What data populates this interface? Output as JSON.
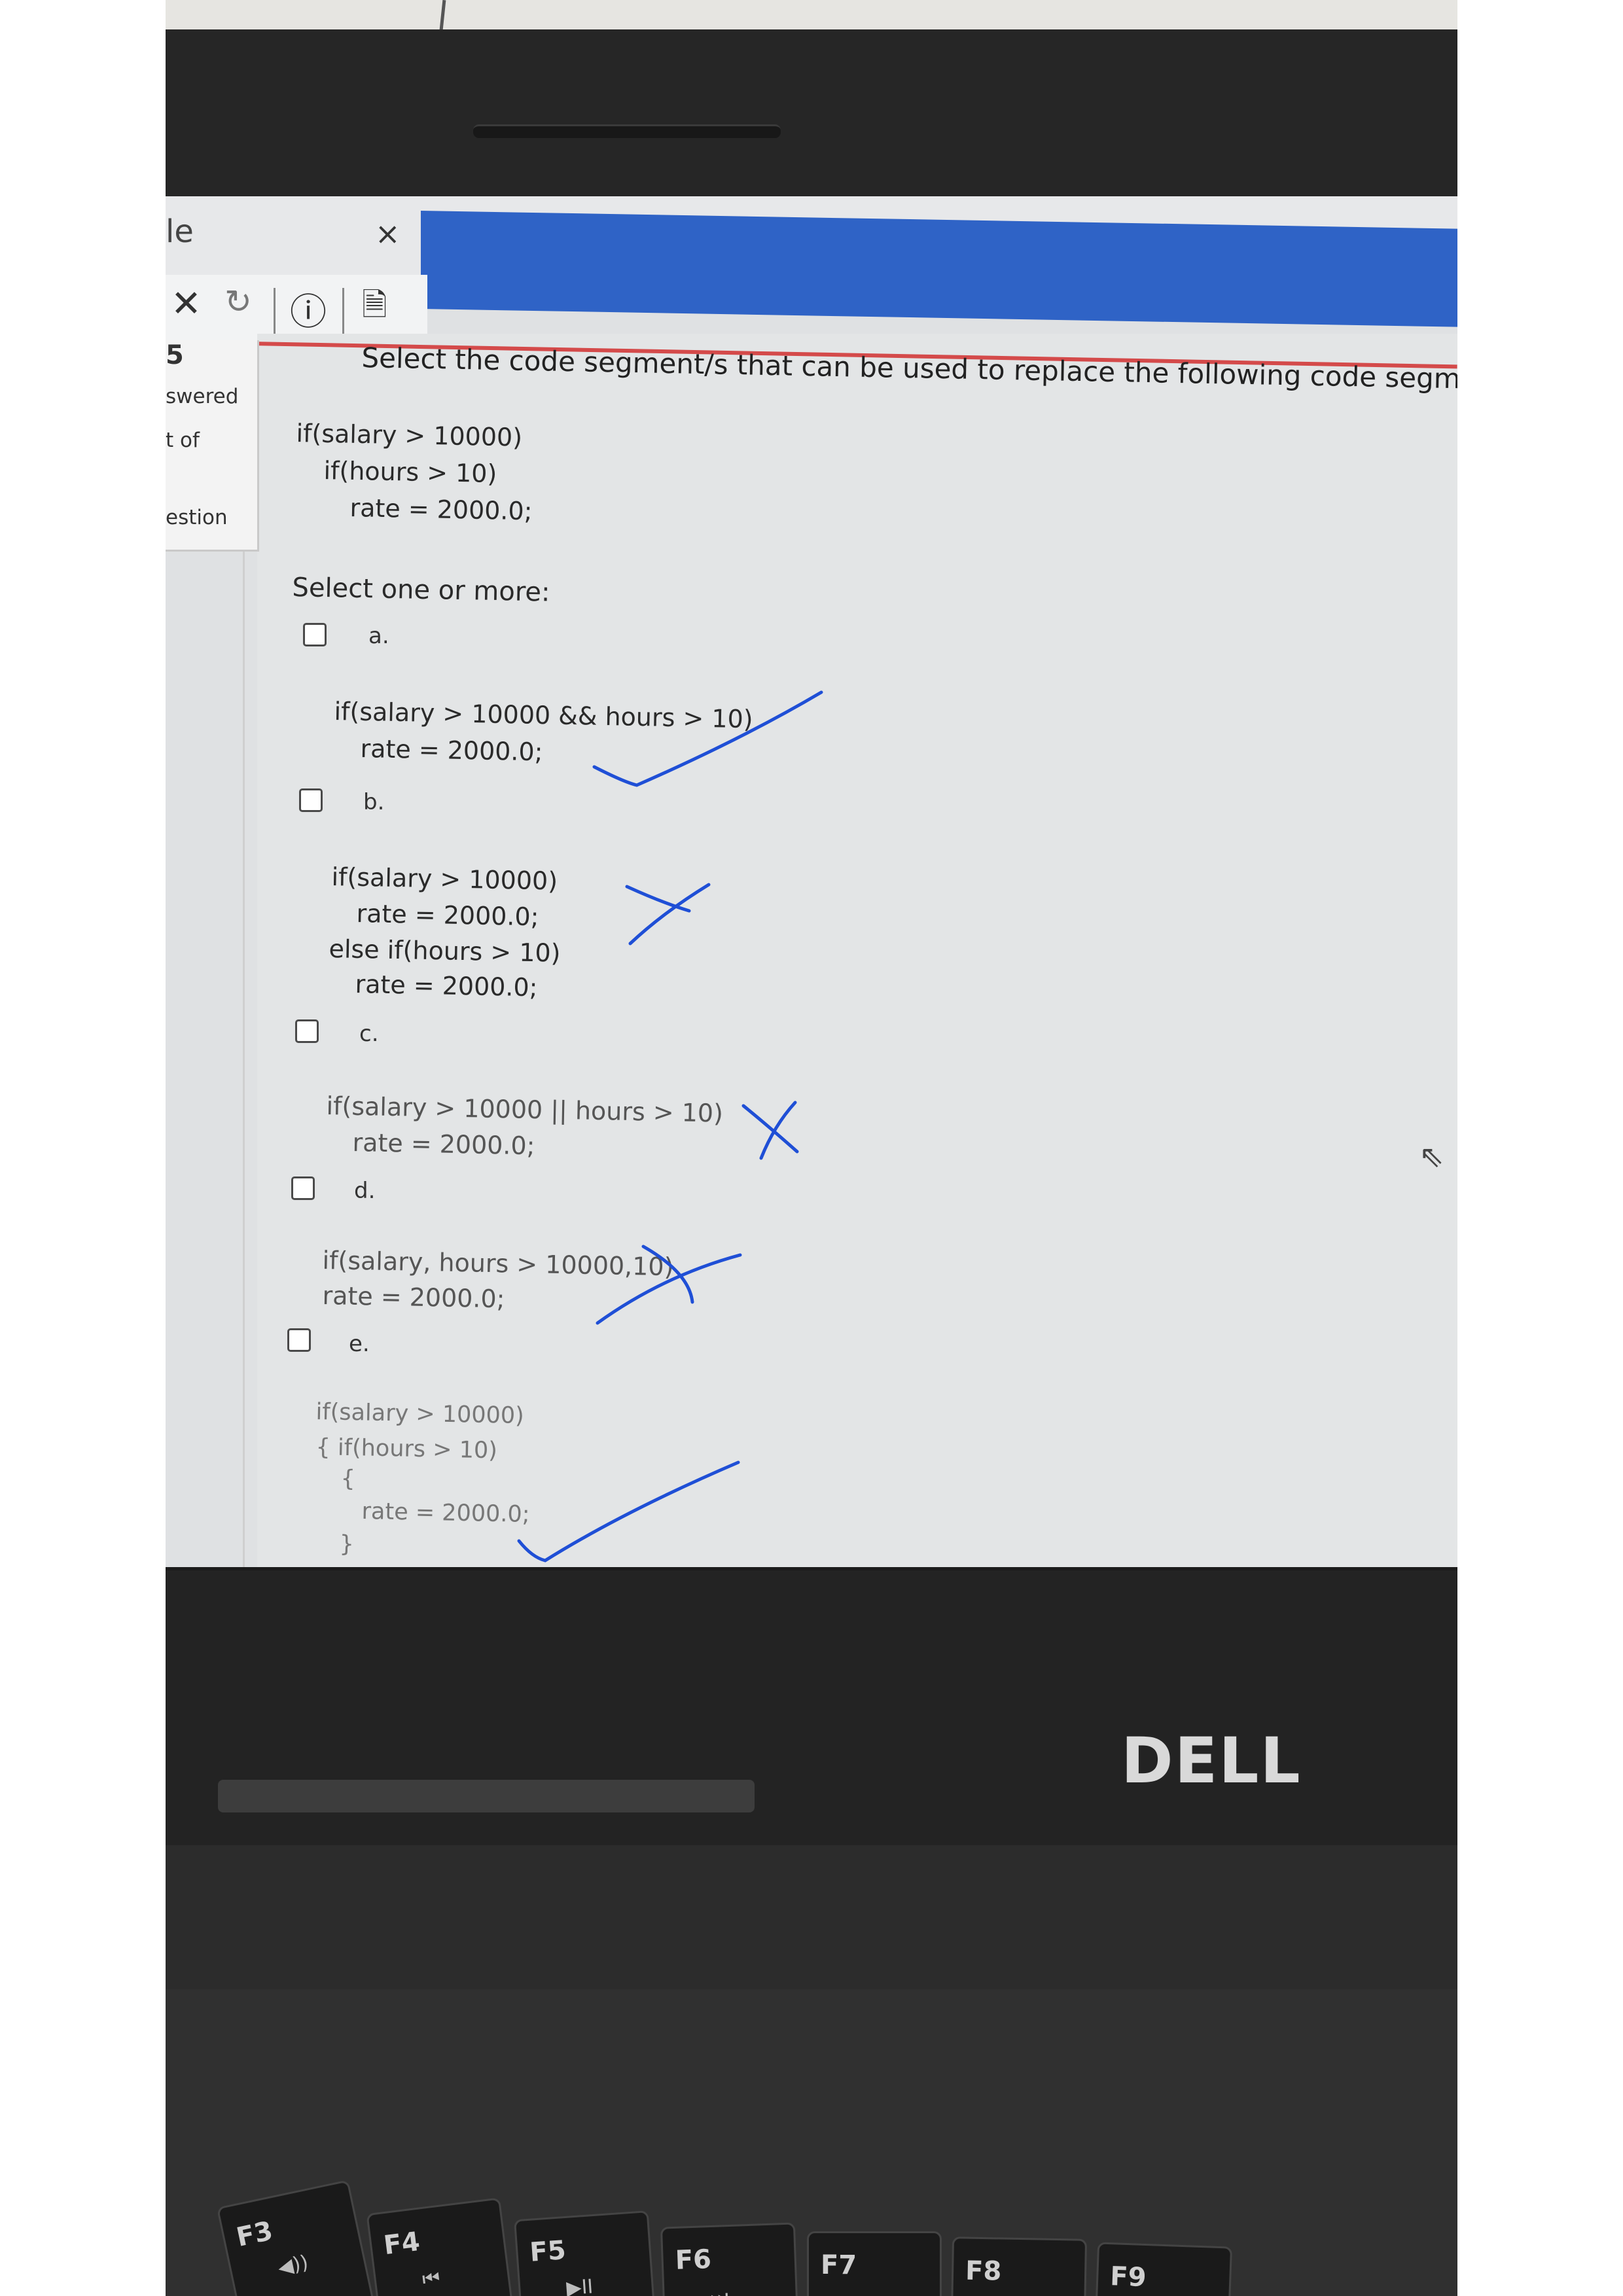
{
  "browser": {
    "tab_fragment": "le",
    "tab_close": "×",
    "toolbar": {
      "stop": "✕",
      "reload": "↻",
      "info": "ⓘ",
      "page": "🗎"
    }
  },
  "sidebar": {
    "number": "5",
    "answered": "swered",
    "out_of": "t of",
    "question": "estion"
  },
  "question": {
    "prompt": "Select the code segment/s that can be used to replace the following code segment.",
    "code": [
      "if(salary > 10000)",
      "if(hours > 10)",
      "rate = 2000.0;"
    ],
    "select_hint": "Select one or more:"
  },
  "options": [
    {
      "label": "a.",
      "lines": [
        "if(salary > 10000 && hours > 10)",
        "rate = 2000.0;"
      ],
      "checked": false,
      "hand_mark": "tick"
    },
    {
      "label": "b.",
      "lines": [
        "if(salary > 10000)",
        "rate = 2000.0;",
        "else if(hours > 10)",
        "rate = 2000.0;"
      ],
      "checked": false,
      "hand_mark": "cross"
    },
    {
      "label": "c.",
      "lines": [
        "if(salary > 10000 || hours > 10)",
        "rate = 2000.0;"
      ],
      "checked": false,
      "hand_mark": "cross"
    },
    {
      "label": "d.",
      "lines": [
        "if(salary, hours > 10000,10)",
        "rate = 2000.0;"
      ],
      "checked": false,
      "hand_mark": "cross"
    },
    {
      "label": "e.",
      "lines": [
        "if(salary > 10000)",
        "{   if(hours > 10)",
        "{",
        "rate = 2000.0;",
        "}"
      ],
      "checked": false,
      "hand_mark": "tick"
    }
  ],
  "colors": {
    "ink": "#1f4fd6",
    "accent_bar": "#2f63c6",
    "red_rule": "#d44a4a"
  },
  "laptop": {
    "brand": "DELL",
    "keys": [
      {
        "label": "F3",
        "sub": "◀))"
      },
      {
        "label": "F4",
        "sub": "⏮"
      },
      {
        "label": "F5",
        "sub": "▶II"
      },
      {
        "label": "F6",
        "sub": "⏭"
      },
      {
        "label": "F7",
        "sub": ""
      },
      {
        "label": "F8",
        "sub": ""
      },
      {
        "label": "F9",
        "sub": ""
      }
    ]
  }
}
